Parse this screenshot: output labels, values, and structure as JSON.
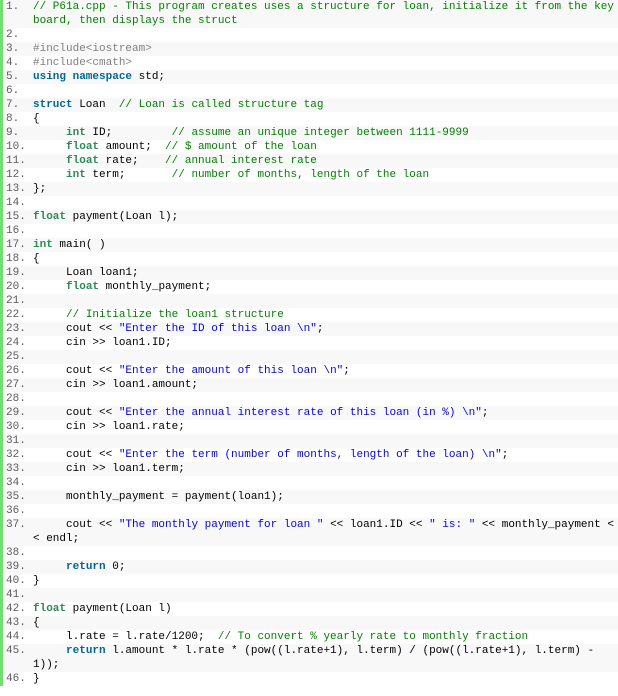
{
  "lines": [
    {
      "n": "1.",
      "t": [
        {
          "c": "cm",
          "s": "// P61a.cpp - This program creates uses a structure for loan, initialize it from the keyboard, then displays the struct"
        }
      ]
    },
    {
      "n": "2.",
      "t": []
    },
    {
      "n": "3.",
      "t": [
        {
          "c": "pp",
          "s": "#include<iostream>"
        }
      ]
    },
    {
      "n": "4.",
      "t": [
        {
          "c": "pp",
          "s": "#include<cmath>"
        }
      ]
    },
    {
      "n": "5.",
      "t": [
        {
          "c": "kw",
          "s": "using namespace"
        },
        {
          "c": "",
          "s": " std;"
        }
      ]
    },
    {
      "n": "6.",
      "t": []
    },
    {
      "n": "7.",
      "t": [
        {
          "c": "kw",
          "s": "struct"
        },
        {
          "c": "",
          "s": " Loan  "
        },
        {
          "c": "cm",
          "s": "// Loan is called structure tag"
        }
      ]
    },
    {
      "n": "8.",
      "t": [
        {
          "c": "",
          "s": "{"
        }
      ]
    },
    {
      "n": "9.",
      "t": [
        {
          "c": "",
          "s": "     "
        },
        {
          "c": "ty",
          "s": "int"
        },
        {
          "c": "",
          "s": " ID;         "
        },
        {
          "c": "cm",
          "s": "// assume an unique integer between 1111-9999"
        }
      ]
    },
    {
      "n": "10.",
      "t": [
        {
          "c": "",
          "s": "     "
        },
        {
          "c": "ty",
          "s": "float"
        },
        {
          "c": "",
          "s": " amount;  "
        },
        {
          "c": "cm",
          "s": "// $ amount of the loan"
        }
      ]
    },
    {
      "n": "11.",
      "t": [
        {
          "c": "",
          "s": "     "
        },
        {
          "c": "ty",
          "s": "float"
        },
        {
          "c": "",
          "s": " rate;    "
        },
        {
          "c": "cm",
          "s": "// annual interest rate"
        }
      ]
    },
    {
      "n": "12.",
      "t": [
        {
          "c": "",
          "s": "     "
        },
        {
          "c": "ty",
          "s": "int"
        },
        {
          "c": "",
          "s": " term;       "
        },
        {
          "c": "cm",
          "s": "// number of months, length of the loan"
        }
      ]
    },
    {
      "n": "13.",
      "t": [
        {
          "c": "",
          "s": "};"
        }
      ]
    },
    {
      "n": "14.",
      "t": []
    },
    {
      "n": "15.",
      "t": [
        {
          "c": "ty",
          "s": "float"
        },
        {
          "c": "",
          "s": " payment(Loan l);"
        }
      ]
    },
    {
      "n": "16.",
      "t": []
    },
    {
      "n": "17.",
      "t": [
        {
          "c": "ty",
          "s": "int"
        },
        {
          "c": "",
          "s": " main( )"
        }
      ]
    },
    {
      "n": "18.",
      "t": [
        {
          "c": "",
          "s": "{"
        }
      ]
    },
    {
      "n": "19.",
      "t": [
        {
          "c": "",
          "s": "     Loan loan1;"
        }
      ]
    },
    {
      "n": "20.",
      "t": [
        {
          "c": "",
          "s": "     "
        },
        {
          "c": "ty",
          "s": "float"
        },
        {
          "c": "",
          "s": " monthly_payment;"
        }
      ]
    },
    {
      "n": "21.",
      "t": []
    },
    {
      "n": "22.",
      "t": [
        {
          "c": "",
          "s": "     "
        },
        {
          "c": "cm",
          "s": "// Initialize the loan1 structure"
        }
      ]
    },
    {
      "n": "23.",
      "t": [
        {
          "c": "",
          "s": "     cout << "
        },
        {
          "c": "st",
          "s": "\"Enter the ID of this loan \\n\""
        },
        {
          "c": "",
          "s": ";"
        }
      ]
    },
    {
      "n": "24.",
      "t": [
        {
          "c": "",
          "s": "     cin >> loan1.ID;"
        }
      ]
    },
    {
      "n": "25.",
      "t": []
    },
    {
      "n": "26.",
      "t": [
        {
          "c": "",
          "s": "     cout << "
        },
        {
          "c": "st",
          "s": "\"Enter the amount of this loan \\n\""
        },
        {
          "c": "",
          "s": ";"
        }
      ]
    },
    {
      "n": "27.",
      "t": [
        {
          "c": "",
          "s": "     cin >> loan1.amount;"
        }
      ]
    },
    {
      "n": "28.",
      "t": []
    },
    {
      "n": "29.",
      "t": [
        {
          "c": "",
          "s": "     cout << "
        },
        {
          "c": "st",
          "s": "\"Enter the annual interest rate of this loan (in %) \\n\""
        },
        {
          "c": "",
          "s": ";"
        }
      ]
    },
    {
      "n": "30.",
      "t": [
        {
          "c": "",
          "s": "     cin >> loan1.rate;"
        }
      ]
    },
    {
      "n": "31.",
      "t": []
    },
    {
      "n": "32.",
      "t": [
        {
          "c": "",
          "s": "     cout << "
        },
        {
          "c": "st",
          "s": "\"Enter the term (number of months, length of the loan) \\n\""
        },
        {
          "c": "",
          "s": ";"
        }
      ]
    },
    {
      "n": "33.",
      "t": [
        {
          "c": "",
          "s": "     cin >> loan1.term;"
        }
      ]
    },
    {
      "n": "34.",
      "t": []
    },
    {
      "n": "35.",
      "t": [
        {
          "c": "",
          "s": "     monthly_payment = payment(loan1);"
        }
      ]
    },
    {
      "n": "36.",
      "t": []
    },
    {
      "n": "37.",
      "t": [
        {
          "c": "",
          "s": "     cout << "
        },
        {
          "c": "st",
          "s": "\"The monthly payment for loan \""
        },
        {
          "c": "",
          "s": " << loan1.ID << "
        },
        {
          "c": "st",
          "s": "\" is: \""
        },
        {
          "c": "",
          "s": " << monthly_payment << endl;"
        }
      ]
    },
    {
      "n": "38.",
      "t": []
    },
    {
      "n": "39.",
      "t": [
        {
          "c": "",
          "s": "     "
        },
        {
          "c": "kw",
          "s": "return"
        },
        {
          "c": "",
          "s": " 0;"
        }
      ]
    },
    {
      "n": "40.",
      "t": [
        {
          "c": "",
          "s": "}"
        }
      ]
    },
    {
      "n": "41.",
      "t": []
    },
    {
      "n": "42.",
      "t": [
        {
          "c": "ty",
          "s": "float"
        },
        {
          "c": "",
          "s": " payment(Loan l)"
        }
      ]
    },
    {
      "n": "43.",
      "t": [
        {
          "c": "",
          "s": "{"
        }
      ]
    },
    {
      "n": "44.",
      "t": [
        {
          "c": "",
          "s": "     l.rate = l.rate/1200;  "
        },
        {
          "c": "cm",
          "s": "// To convert % yearly rate to monthly fraction"
        }
      ]
    },
    {
      "n": "45.",
      "t": [
        {
          "c": "",
          "s": "     "
        },
        {
          "c": "kw",
          "s": "return"
        },
        {
          "c": "",
          "s": " l.amount * l.rate * (pow((l.rate+1), l.term) / (pow((l.rate+1), l.term) - 1));"
        }
      ]
    },
    {
      "n": "46.",
      "t": [
        {
          "c": "",
          "s": "}"
        }
      ]
    }
  ]
}
